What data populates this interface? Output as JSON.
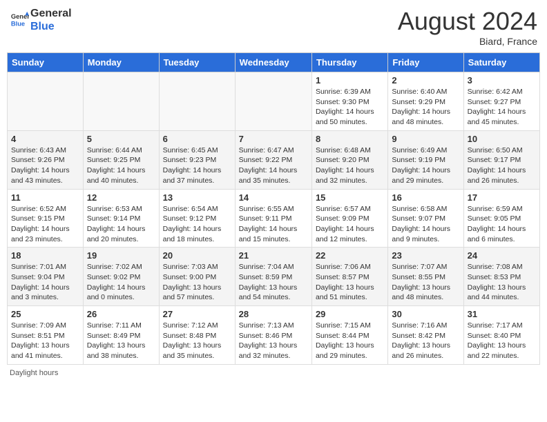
{
  "header": {
    "logo_line1": "General",
    "logo_line2": "Blue",
    "month_year": "August 2024",
    "location": "Biard, France"
  },
  "days_of_week": [
    "Sunday",
    "Monday",
    "Tuesday",
    "Wednesday",
    "Thursday",
    "Friday",
    "Saturday"
  ],
  "weeks": [
    [
      {
        "day": "",
        "sunrise": "",
        "sunset": "",
        "daylight": ""
      },
      {
        "day": "",
        "sunrise": "",
        "sunset": "",
        "daylight": ""
      },
      {
        "day": "",
        "sunrise": "",
        "sunset": "",
        "daylight": ""
      },
      {
        "day": "",
        "sunrise": "",
        "sunset": "",
        "daylight": ""
      },
      {
        "day": "1",
        "sunrise": "Sunrise: 6:39 AM",
        "sunset": "Sunset: 9:30 PM",
        "daylight": "Daylight: 14 hours and 50 minutes."
      },
      {
        "day": "2",
        "sunrise": "Sunrise: 6:40 AM",
        "sunset": "Sunset: 9:29 PM",
        "daylight": "Daylight: 14 hours and 48 minutes."
      },
      {
        "day": "3",
        "sunrise": "Sunrise: 6:42 AM",
        "sunset": "Sunset: 9:27 PM",
        "daylight": "Daylight: 14 hours and 45 minutes."
      }
    ],
    [
      {
        "day": "4",
        "sunrise": "Sunrise: 6:43 AM",
        "sunset": "Sunset: 9:26 PM",
        "daylight": "Daylight: 14 hours and 43 minutes."
      },
      {
        "day": "5",
        "sunrise": "Sunrise: 6:44 AM",
        "sunset": "Sunset: 9:25 PM",
        "daylight": "Daylight: 14 hours and 40 minutes."
      },
      {
        "day": "6",
        "sunrise": "Sunrise: 6:45 AM",
        "sunset": "Sunset: 9:23 PM",
        "daylight": "Daylight: 14 hours and 37 minutes."
      },
      {
        "day": "7",
        "sunrise": "Sunrise: 6:47 AM",
        "sunset": "Sunset: 9:22 PM",
        "daylight": "Daylight: 14 hours and 35 minutes."
      },
      {
        "day": "8",
        "sunrise": "Sunrise: 6:48 AM",
        "sunset": "Sunset: 9:20 PM",
        "daylight": "Daylight: 14 hours and 32 minutes."
      },
      {
        "day": "9",
        "sunrise": "Sunrise: 6:49 AM",
        "sunset": "Sunset: 9:19 PM",
        "daylight": "Daylight: 14 hours and 29 minutes."
      },
      {
        "day": "10",
        "sunrise": "Sunrise: 6:50 AM",
        "sunset": "Sunset: 9:17 PM",
        "daylight": "Daylight: 14 hours and 26 minutes."
      }
    ],
    [
      {
        "day": "11",
        "sunrise": "Sunrise: 6:52 AM",
        "sunset": "Sunset: 9:15 PM",
        "daylight": "Daylight: 14 hours and 23 minutes."
      },
      {
        "day": "12",
        "sunrise": "Sunrise: 6:53 AM",
        "sunset": "Sunset: 9:14 PM",
        "daylight": "Daylight: 14 hours and 20 minutes."
      },
      {
        "day": "13",
        "sunrise": "Sunrise: 6:54 AM",
        "sunset": "Sunset: 9:12 PM",
        "daylight": "Daylight: 14 hours and 18 minutes."
      },
      {
        "day": "14",
        "sunrise": "Sunrise: 6:55 AM",
        "sunset": "Sunset: 9:11 PM",
        "daylight": "Daylight: 14 hours and 15 minutes."
      },
      {
        "day": "15",
        "sunrise": "Sunrise: 6:57 AM",
        "sunset": "Sunset: 9:09 PM",
        "daylight": "Daylight: 14 hours and 12 minutes."
      },
      {
        "day": "16",
        "sunrise": "Sunrise: 6:58 AM",
        "sunset": "Sunset: 9:07 PM",
        "daylight": "Daylight: 14 hours and 9 minutes."
      },
      {
        "day": "17",
        "sunrise": "Sunrise: 6:59 AM",
        "sunset": "Sunset: 9:05 PM",
        "daylight": "Daylight: 14 hours and 6 minutes."
      }
    ],
    [
      {
        "day": "18",
        "sunrise": "Sunrise: 7:01 AM",
        "sunset": "Sunset: 9:04 PM",
        "daylight": "Daylight: 14 hours and 3 minutes."
      },
      {
        "day": "19",
        "sunrise": "Sunrise: 7:02 AM",
        "sunset": "Sunset: 9:02 PM",
        "daylight": "Daylight: 14 hours and 0 minutes."
      },
      {
        "day": "20",
        "sunrise": "Sunrise: 7:03 AM",
        "sunset": "Sunset: 9:00 PM",
        "daylight": "Daylight: 13 hours and 57 minutes."
      },
      {
        "day": "21",
        "sunrise": "Sunrise: 7:04 AM",
        "sunset": "Sunset: 8:59 PM",
        "daylight": "Daylight: 13 hours and 54 minutes."
      },
      {
        "day": "22",
        "sunrise": "Sunrise: 7:06 AM",
        "sunset": "Sunset: 8:57 PM",
        "daylight": "Daylight: 13 hours and 51 minutes."
      },
      {
        "day": "23",
        "sunrise": "Sunrise: 7:07 AM",
        "sunset": "Sunset: 8:55 PM",
        "daylight": "Daylight: 13 hours and 48 minutes."
      },
      {
        "day": "24",
        "sunrise": "Sunrise: 7:08 AM",
        "sunset": "Sunset: 8:53 PM",
        "daylight": "Daylight: 13 hours and 44 minutes."
      }
    ],
    [
      {
        "day": "25",
        "sunrise": "Sunrise: 7:09 AM",
        "sunset": "Sunset: 8:51 PM",
        "daylight": "Daylight: 13 hours and 41 minutes."
      },
      {
        "day": "26",
        "sunrise": "Sunrise: 7:11 AM",
        "sunset": "Sunset: 8:49 PM",
        "daylight": "Daylight: 13 hours and 38 minutes."
      },
      {
        "day": "27",
        "sunrise": "Sunrise: 7:12 AM",
        "sunset": "Sunset: 8:48 PM",
        "daylight": "Daylight: 13 hours and 35 minutes."
      },
      {
        "day": "28",
        "sunrise": "Sunrise: 7:13 AM",
        "sunset": "Sunset: 8:46 PM",
        "daylight": "Daylight: 13 hours and 32 minutes."
      },
      {
        "day": "29",
        "sunrise": "Sunrise: 7:15 AM",
        "sunset": "Sunset: 8:44 PM",
        "daylight": "Daylight: 13 hours and 29 minutes."
      },
      {
        "day": "30",
        "sunrise": "Sunrise: 7:16 AM",
        "sunset": "Sunset: 8:42 PM",
        "daylight": "Daylight: 13 hours and 26 minutes."
      },
      {
        "day": "31",
        "sunrise": "Sunrise: 7:17 AM",
        "sunset": "Sunset: 8:40 PM",
        "daylight": "Daylight: 13 hours and 22 minutes."
      }
    ]
  ],
  "footer": {
    "text": "Daylight hours"
  }
}
